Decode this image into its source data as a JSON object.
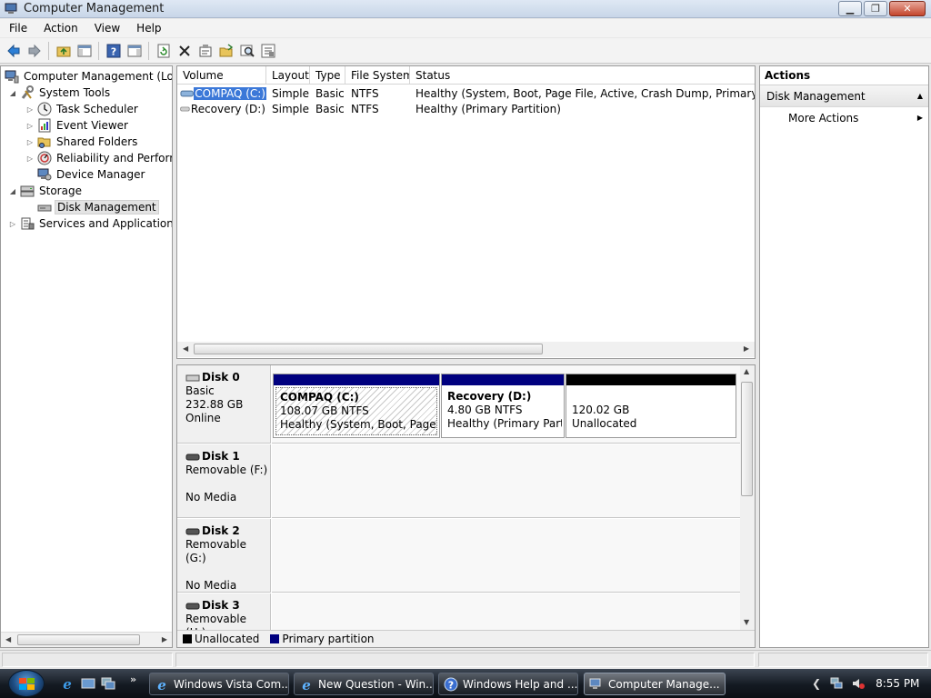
{
  "window": {
    "title": "Computer Management"
  },
  "menu": [
    "File",
    "Action",
    "View",
    "Help"
  ],
  "tree": {
    "root": "Computer Management (Local)",
    "system_tools": "System Tools",
    "task_scheduler": "Task Scheduler",
    "event_viewer": "Event Viewer",
    "shared_folders": "Shared Folders",
    "reliability": "Reliability and Performance",
    "device_manager": "Device Manager",
    "storage": "Storage",
    "disk_management": "Disk Management",
    "services": "Services and Applications"
  },
  "volume_list": {
    "columns": [
      "Volume",
      "Layout",
      "Type",
      "File System",
      "Status"
    ],
    "rows": [
      {
        "volume": "COMPAQ (C:)",
        "layout": "Simple",
        "type": "Basic",
        "fs": "NTFS",
        "status": "Healthy (System, Boot, Page File, Active, Crash Dump, Primary Partition)"
      },
      {
        "volume": "Recovery (D:)",
        "layout": "Simple",
        "type": "Basic",
        "fs": "NTFS",
        "status": "Healthy (Primary Partition)"
      }
    ]
  },
  "disks": [
    {
      "name": "Disk 0",
      "line1": "Basic",
      "line2": "232.88 GB",
      "line3": "Online"
    },
    {
      "name": "Disk 1",
      "line1": "Removable (F:)",
      "line2": "",
      "line3": "No Media"
    },
    {
      "name": "Disk 2",
      "line1": "Removable (G:)",
      "line2": "",
      "line3": "No Media"
    },
    {
      "name": "Disk 3",
      "line1": "Removable (H:)",
      "line2": "",
      "line3": ""
    }
  ],
  "partitions": [
    {
      "name": "COMPAQ  (C:)",
      "size": "108.07 GB NTFS",
      "status": "Healthy (System, Boot, Page File"
    },
    {
      "name": "Recovery  (D:)",
      "size": "4.80 GB NTFS",
      "status": "Healthy (Primary Partit"
    },
    {
      "name": "",
      "size": "120.02 GB",
      "status": "Unallocated"
    }
  ],
  "legend": {
    "unallocated": "Unallocated",
    "primary": "Primary partition"
  },
  "colors": {
    "primary": "#00007f",
    "unallocated": "#000000",
    "selection": "#3b78d8"
  },
  "actions": {
    "header": "Actions",
    "group": "Disk Management",
    "more": "More Actions"
  },
  "taskbar": {
    "tasks": [
      "Windows Vista Com...",
      "New Question - Win...",
      "Windows Help and ...",
      "Computer Manage..."
    ],
    "clock": "8:55 PM"
  }
}
